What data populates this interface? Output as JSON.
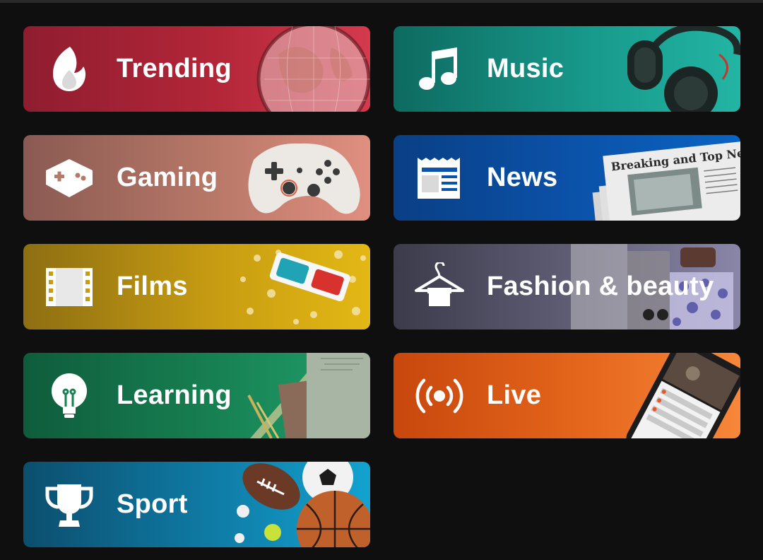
{
  "categories": [
    {
      "id": "trending",
      "label": "Trending",
      "icon": "trending-flame-icon",
      "color": "#b22638"
    },
    {
      "id": "gaming",
      "label": "Gaming",
      "icon": "gamepad-icon",
      "color": "#b87868"
    },
    {
      "id": "films",
      "label": "Films",
      "icon": "film-strip-icon",
      "color": "#c79c12"
    },
    {
      "id": "learning",
      "label": "Learning",
      "icon": "lightbulb-icon",
      "color": "#178052"
    },
    {
      "id": "sport",
      "label": "Sport",
      "icon": "trophy-icon",
      "color": "#0f7ca6"
    },
    {
      "id": "music",
      "label": "Music",
      "icon": "music-note-icon",
      "color": "#17988a"
    },
    {
      "id": "news",
      "label": "News",
      "icon": "newspaper-icon",
      "color": "#0b53ab"
    },
    {
      "id": "fashion",
      "label": "Fashion & beauty",
      "icon": "hanger-icon",
      "color": "#626078"
    },
    {
      "id": "live",
      "label": "Live",
      "icon": "live-broadcast-icon",
      "color": "#e5661c"
    }
  ],
  "news_art_headline": "Breaking and Top News"
}
